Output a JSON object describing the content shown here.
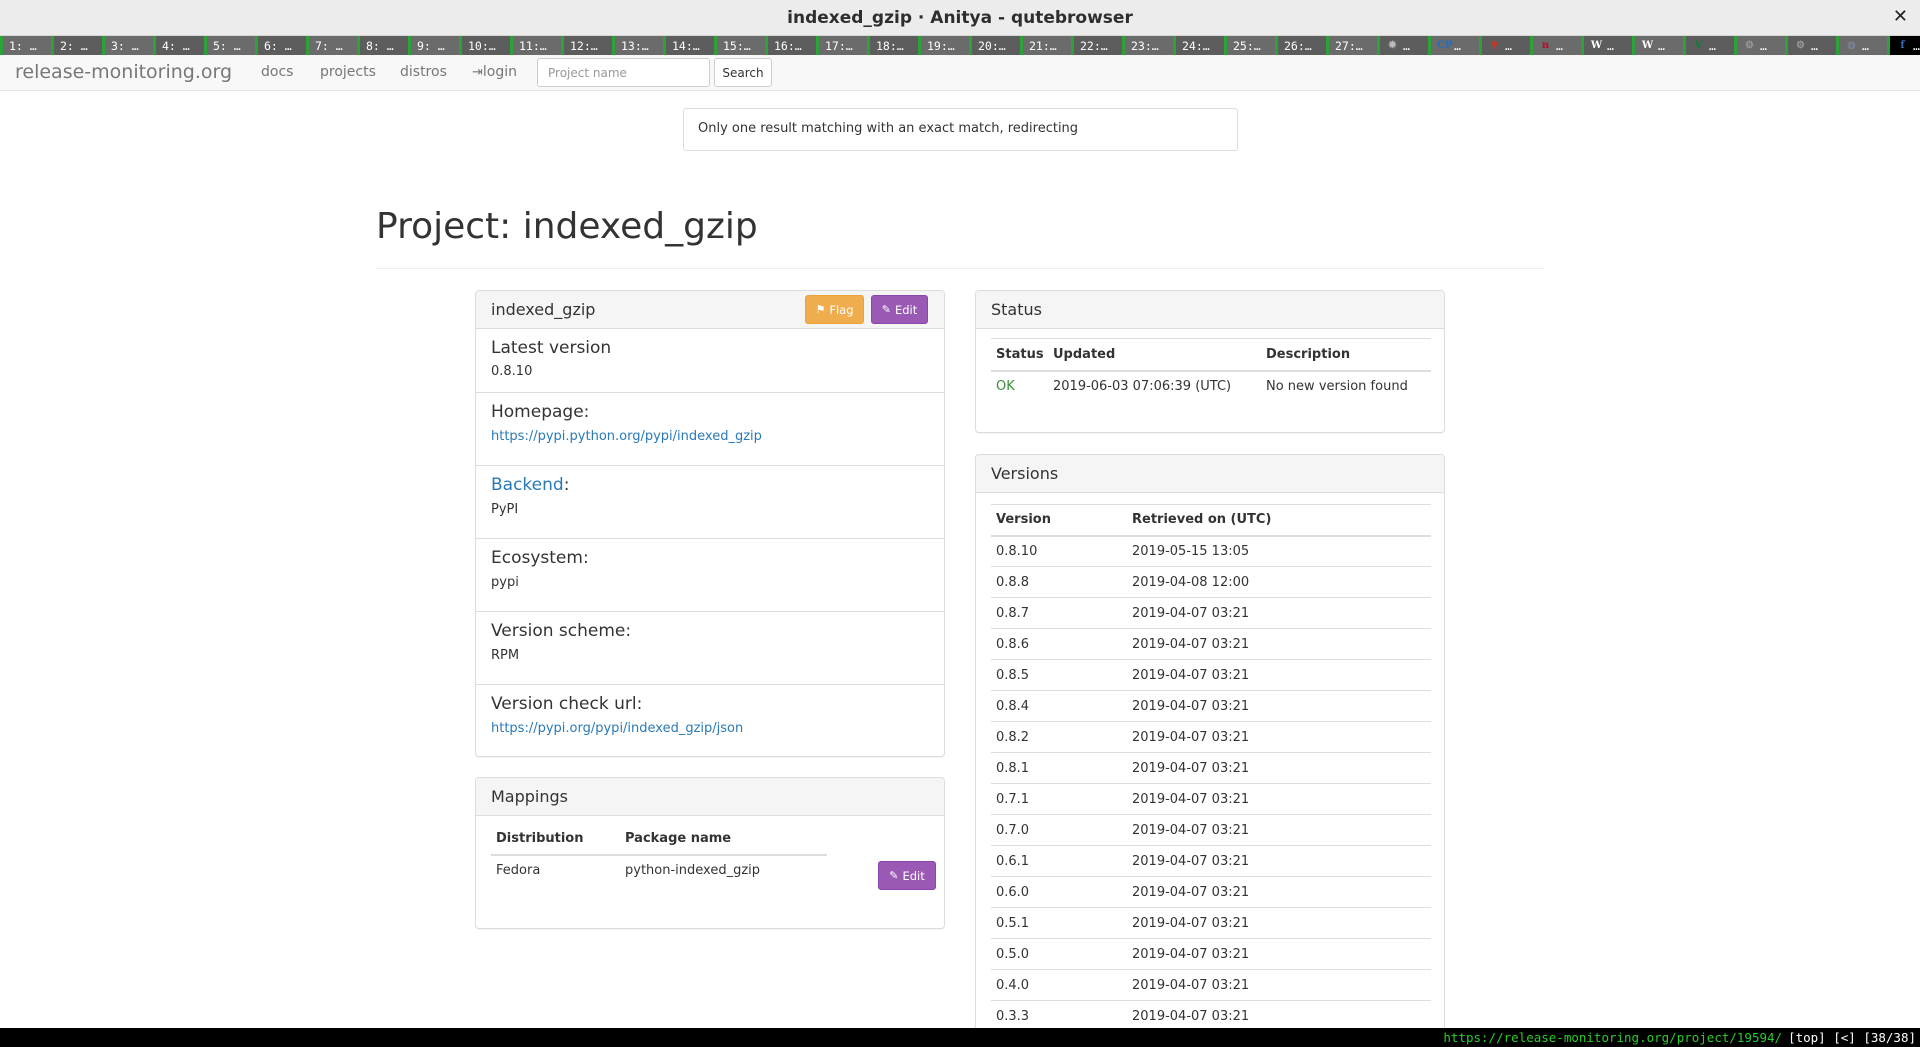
{
  "window": {
    "title": "indexed_gzip · Anitya - qutebrowser",
    "close_glyph": "✕"
  },
  "tabs": [
    {
      "label": "1: …"
    },
    {
      "label": "2: …"
    },
    {
      "label": "3: …"
    },
    {
      "label": "4: …"
    },
    {
      "label": "5: …"
    },
    {
      "label": "6: …"
    },
    {
      "label": "7: …"
    },
    {
      "label": "8: …"
    },
    {
      "label": "9: …"
    },
    {
      "label": "10:…"
    },
    {
      "label": "11:…"
    },
    {
      "label": "12:…"
    },
    {
      "label": "13:…"
    },
    {
      "label": "14:…"
    },
    {
      "label": "15:…"
    },
    {
      "label": "16:…"
    },
    {
      "label": "17:…"
    },
    {
      "label": "18:…"
    },
    {
      "label": "19:…"
    },
    {
      "label": "20:…"
    },
    {
      "label": "21:…"
    },
    {
      "label": "22:…"
    },
    {
      "label": "23:…"
    },
    {
      "label": "24:…"
    },
    {
      "label": "25:…"
    },
    {
      "label": "26:…"
    },
    {
      "label": "27:…"
    },
    {
      "label": "…",
      "icon": "bug-icon",
      "glyph": "✹",
      "icon_color": "#bbbbbb"
    },
    {
      "label": "…",
      "icon": "cp-icon",
      "glyph": "CP",
      "icon_color": "#1e6fc4"
    },
    {
      "label": "…",
      "icon": "shield-icon",
      "glyph": "▼",
      "icon_color": "#c0392b"
    },
    {
      "label": "…",
      "icon": "n-icon",
      "glyph": "n",
      "icon_color": "#b0102a"
    },
    {
      "label": "…",
      "icon": "wikipedia-icon",
      "glyph": "W",
      "icon_color": "#ffffff"
    },
    {
      "label": "…",
      "icon": "wikipedia-icon",
      "glyph": "W",
      "icon_color": "#ffffff"
    },
    {
      "label": "…",
      "icon": "vim-icon",
      "glyph": "V",
      "icon_color": "#0f7b3a"
    },
    {
      "label": "…",
      "icon": "gear-icon",
      "glyph": "⚙",
      "icon_color": "#999999"
    },
    {
      "label": "…",
      "icon": "gear-icon",
      "glyph": "⚙",
      "icon_color": "#999999"
    },
    {
      "label": "…",
      "icon": "globe-icon",
      "glyph": "◍",
      "icon_color": "#7f8fa6"
    },
    {
      "label": "…",
      "icon": "fedora-icon",
      "glyph": "f",
      "icon_color": "#3c6eb4",
      "active": true
    }
  ],
  "navbar": {
    "brand": "release-monitoring.org",
    "links": {
      "docs": "docs",
      "projects": "projects",
      "distros": "distros",
      "login": "login"
    },
    "search_placeholder": "Project name",
    "search_button": "Search"
  },
  "flash": "Only one result matching with an exact match, redirecting",
  "page_title": "Project: indexed_gzip",
  "project": {
    "name": "indexed_gzip",
    "flag_label": "Flag",
    "edit_label": "Edit",
    "latest_version_label": "Latest version",
    "latest_version": "0.8.10",
    "homepage_label": "Homepage:",
    "homepage": "https://pypi.python.org/pypi/indexed_gzip",
    "backend_label": "Backend",
    "backend_colon": ":",
    "backend": "PyPI",
    "ecosystem_label": "Ecosystem:",
    "ecosystem": "pypi",
    "version_scheme_label": "Version scheme:",
    "version_scheme": "RPM",
    "version_check_url_label": "Version check url:",
    "version_check_url": "https://pypi.org/pypi/indexed_gzip/json"
  },
  "mappings": {
    "title": "Mappings",
    "headers": [
      "Distribution",
      "Package name"
    ],
    "rows": [
      {
        "distribution": "Fedora",
        "package": "python-indexed_gzip",
        "edit": "Edit"
      }
    ]
  },
  "status": {
    "title": "Status",
    "headers": [
      "Status",
      "Updated",
      "Description"
    ],
    "rows": [
      {
        "status": "OK",
        "updated": "2019-06-03 07:06:39 (UTC)",
        "description": "No new version found"
      }
    ],
    "ok_color": "#3c8c3c"
  },
  "versions": {
    "title": "Versions",
    "headers": [
      "Version",
      "Retrieved on (UTC)"
    ],
    "rows": [
      [
        "0.8.10",
        "2019-05-15 13:05"
      ],
      [
        "0.8.8",
        "2019-04-08 12:00"
      ],
      [
        "0.8.7",
        "2019-04-07 03:21"
      ],
      [
        "0.8.6",
        "2019-04-07 03:21"
      ],
      [
        "0.8.5",
        "2019-04-07 03:21"
      ],
      [
        "0.8.4",
        "2019-04-07 03:21"
      ],
      [
        "0.8.2",
        "2019-04-07 03:21"
      ],
      [
        "0.8.1",
        "2019-04-07 03:21"
      ],
      [
        "0.7.1",
        "2019-04-07 03:21"
      ],
      [
        "0.7.0",
        "2019-04-07 03:21"
      ],
      [
        "0.6.1",
        "2019-04-07 03:21"
      ],
      [
        "0.6.0",
        "2019-04-07 03:21"
      ],
      [
        "0.5.1",
        "2019-04-07 03:21"
      ],
      [
        "0.5.0",
        "2019-04-07 03:21"
      ],
      [
        "0.4.0",
        "2019-04-07 03:21"
      ],
      [
        "0.3.3",
        "2019-04-07 03:21"
      ]
    ]
  },
  "statusbar": {
    "url": "https://release-monitoring.org/project/19594/",
    "info": "[top] [<] [38/38]"
  },
  "colors": {
    "accent_link": "#2a7ab8",
    "flag": "#f0ad4e",
    "edit": "#9b59b6",
    "tab_indicator": "#2ba336"
  }
}
